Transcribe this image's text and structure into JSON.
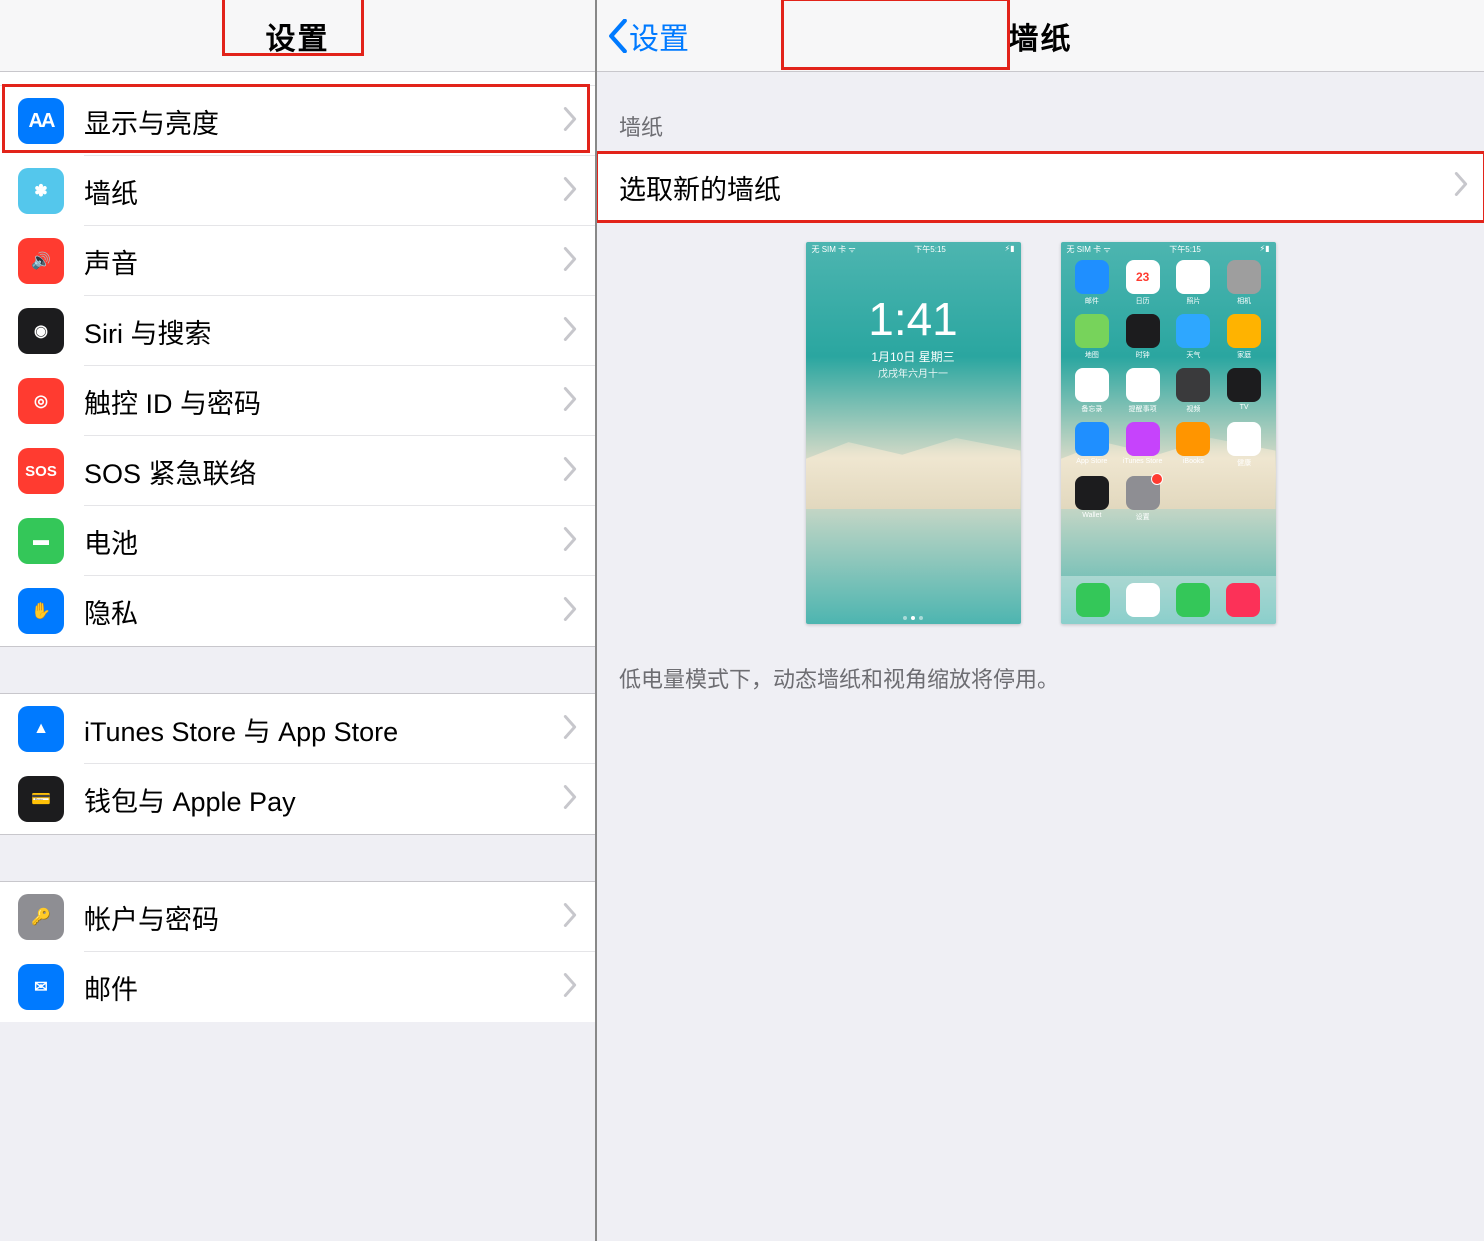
{
  "leftPanel": {
    "title": "设置",
    "rows": [
      {
        "key": "display",
        "label": "显示与亮度",
        "iconName": "display-brightness-icon",
        "iconBg": "bg-blue",
        "iconText": "AA"
      },
      {
        "key": "wallpaper",
        "label": "墙纸",
        "iconName": "wallpaper-icon",
        "iconBg": "bg-cyan",
        "iconText": "✽"
      },
      {
        "key": "sound",
        "label": "声音",
        "iconName": "sound-icon",
        "iconBg": "bg-red",
        "iconText": "🔊"
      },
      {
        "key": "siri",
        "label": "Siri 与搜索",
        "iconName": "siri-icon",
        "iconBg": "bg-dark",
        "iconText": "◉"
      },
      {
        "key": "touchid",
        "label": "触控 ID 与密码",
        "iconName": "touch-id-icon",
        "iconBg": "bg-red",
        "iconText": "◎"
      },
      {
        "key": "sos",
        "label": "SOS 紧急联络",
        "iconName": "sos-icon",
        "iconBg": "bg-red",
        "iconText": "SOS"
      },
      {
        "key": "battery",
        "label": "电池",
        "iconName": "battery-icon",
        "iconBg": "bg-green",
        "iconText": "▬"
      },
      {
        "key": "privacy",
        "label": "隐私",
        "iconName": "privacy-icon",
        "iconBg": "bg-blue",
        "iconText": "✋"
      }
    ],
    "group2": [
      {
        "key": "itunes",
        "label": "iTunes Store 与 App Store",
        "iconName": "app-store-icon",
        "iconBg": "bg-blue",
        "iconText": "▲"
      },
      {
        "key": "wallet",
        "label": "钱包与 Apple Pay",
        "iconName": "wallet-icon",
        "iconBg": "bg-black",
        "iconText": "💳"
      }
    ],
    "group3": [
      {
        "key": "accounts",
        "label": "帐户与密码",
        "iconName": "accounts-passwords-icon",
        "iconBg": "bg-gray",
        "iconText": "🔑"
      },
      {
        "key": "mail",
        "label": "邮件",
        "iconName": "mail-icon",
        "iconBg": "bg-blue",
        "iconText": "✉"
      }
    ]
  },
  "rightPanel": {
    "backLabel": "设置",
    "title": "墙纸",
    "sectionHeader": "墙纸",
    "chooseLabel": "选取新的墙纸",
    "footerNote": "低电量模式下，动态墙纸和视角缩放将停用。",
    "lockPreview": {
      "statusLeft": "无 SIM 卡 ᯤ",
      "statusCenter": "下午5:15",
      "statusRight": "⚡︎▮",
      "time": "1:41",
      "date": "1月10日 星期三",
      "lunar": "戊戌年六月十一"
    },
    "homePreview": {
      "statusLeft": "无 SIM 卡 ᯤ",
      "statusCenter": "下午5:15",
      "statusRight": "⚡︎▮",
      "apps": [
        {
          "label": "邮件",
          "bg": "#1f8fff"
        },
        {
          "label": "日历",
          "bg": "#ffffff",
          "text": "23"
        },
        {
          "label": "照片",
          "bg": "#ffffff"
        },
        {
          "label": "相机",
          "bg": "#9e9e9e"
        },
        {
          "label": "地图",
          "bg": "#77d35b"
        },
        {
          "label": "时钟",
          "bg": "#1c1c1e"
        },
        {
          "label": "天气",
          "bg": "#2ea7ff"
        },
        {
          "label": "家庭",
          "bg": "#ffb300"
        },
        {
          "label": "备忘录",
          "bg": "#ffffff"
        },
        {
          "label": "提醒事项",
          "bg": "#ffffff"
        },
        {
          "label": "视频",
          "bg": "#3a3a3c"
        },
        {
          "label": "TV",
          "bg": "#1c1c1e"
        },
        {
          "label": "App Store",
          "bg": "#1f8fff"
        },
        {
          "label": "iTunes Store",
          "bg": "#c643fc"
        },
        {
          "label": "iBooks",
          "bg": "#ff9500"
        },
        {
          "label": "健康",
          "bg": "#ffffff"
        },
        {
          "label": "Wallet",
          "bg": "#1c1c1e"
        },
        {
          "label": "设置",
          "bg": "#8e8e93",
          "badge": true
        }
      ],
      "dock": [
        {
          "bg": "#34c759"
        },
        {
          "bg": "#ffffff"
        },
        {
          "bg": "#34c759"
        },
        {
          "bg": "#fc3158"
        }
      ]
    }
  }
}
